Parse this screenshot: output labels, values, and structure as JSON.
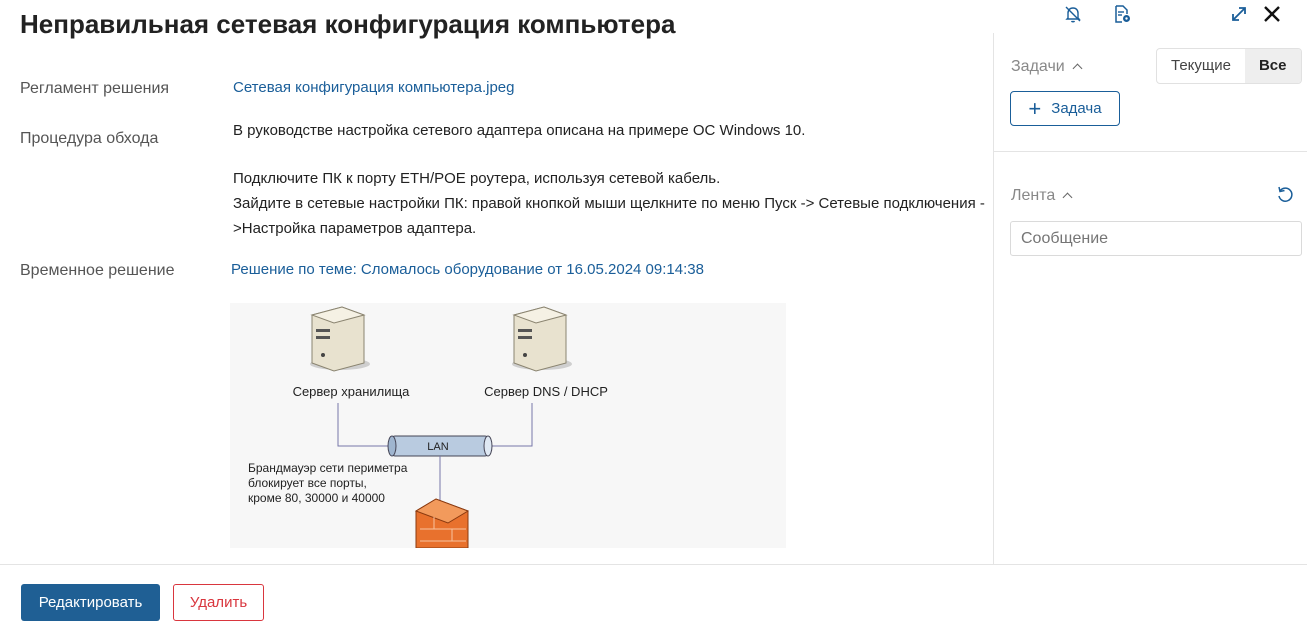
{
  "header": {
    "title": "Неправильная сетевая конфигурация компьютера",
    "icons": [
      "bell-off-icon",
      "document-settings-icon",
      "expand-icon",
      "close-icon"
    ]
  },
  "fields": {
    "regulation_label": "Регламент решения",
    "regulation_link": "Сетевая конфигурация компьютера.jpeg",
    "workaround_label": "Процедура обхода",
    "workaround_lines": [
      "В руководстве настройка сетевого адаптера описана на примере ОС Windows 10.",
      "Подключите ПК к порту ETH/POE роутера, используя сетевой кабель.",
      "Зайдите в сетевые настройки ПК: правой кнопкой мыши щелкните по меню Пуск -> Сетевые подключения -",
      ">Настройка параметров адаптера."
    ],
    "temp_label": "Временное решение",
    "temp_link": "Решение по теме: Сломалось оборудование от 16.05.2024 09:14:38"
  },
  "diagram": {
    "server1": "Сервер хранилища",
    "server2": "Сервер DNS / DHCP",
    "lan": "LAN",
    "firewall_lines": [
      "Брандмауэр сети периметра",
      "блокирует все порты,",
      "кроме 80, 30000 и 40000"
    ]
  },
  "sidebar": {
    "tasks_title": "Задачи",
    "filter_current": "Текущие",
    "filter_all": "Все",
    "add_task": "Задача",
    "feed_title": "Лента",
    "message_placeholder": "Сообщение"
  },
  "footer": {
    "edit": "Редактировать",
    "delete": "Удалить"
  }
}
